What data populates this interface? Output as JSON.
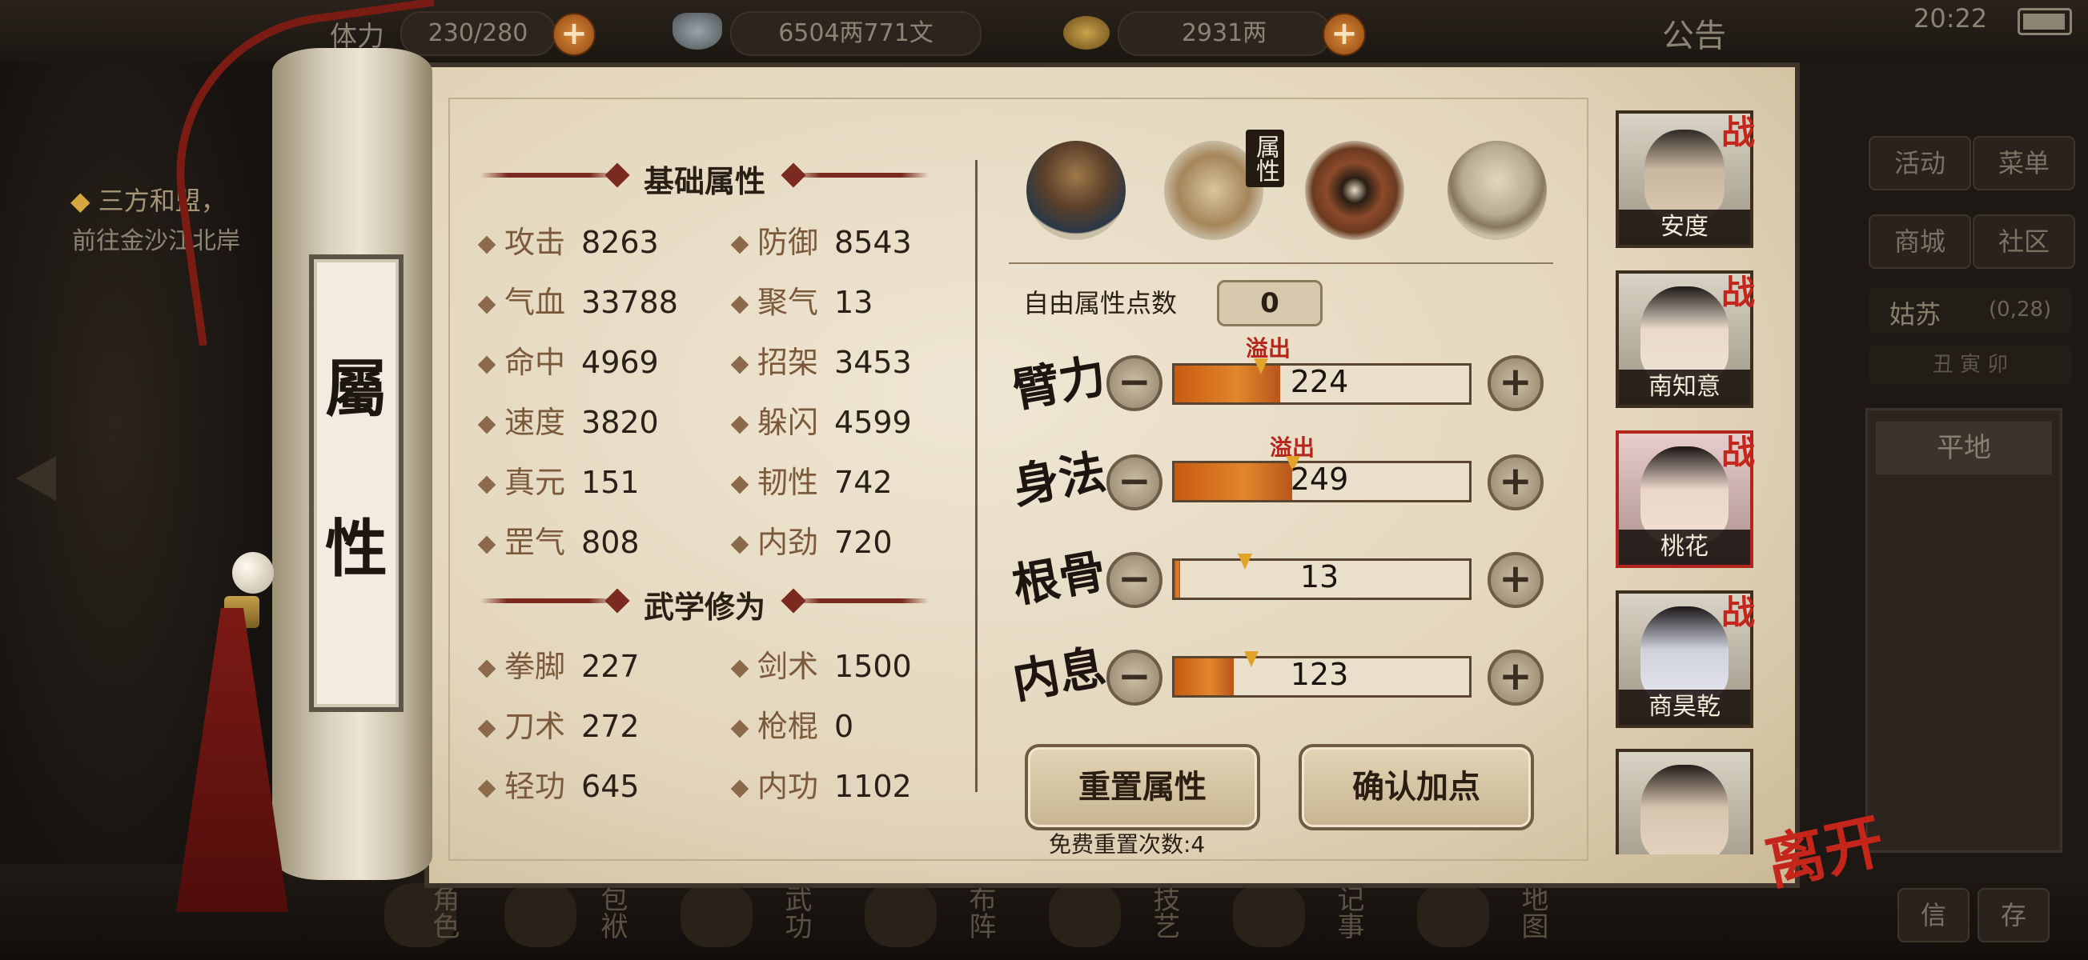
{
  "topbar": {
    "stamina_label": "体力",
    "stamina_value": "230/280",
    "silver_value": "6504两771文",
    "gold_value": "2931两",
    "announcement": "公告",
    "clock": "20:22"
  },
  "left_quest": {
    "title": "三方和盟，",
    "desc": "前往金沙江北岸"
  },
  "right_menu": {
    "activity": "活动",
    "menu": "菜单",
    "mall": "商城",
    "community": "社区",
    "location": "姑苏",
    "coords": "(0,28)",
    "time_line": "丑  寅  卯",
    "terrain": "平地",
    "btn1": "信",
    "btn2": "存"
  },
  "bottom_nav": [
    "角色",
    "包袱",
    "武功",
    "布阵",
    "技艺",
    "记事",
    "地图"
  ],
  "scroll_title": [
    "屬",
    "性"
  ],
  "basic_section": {
    "title": "基础属性",
    "stats": [
      {
        "name": "攻击",
        "value": "8263"
      },
      {
        "name": "防御",
        "value": "8543"
      },
      {
        "name": "气血",
        "value": "33788"
      },
      {
        "name": "聚气",
        "value": "13"
      },
      {
        "name": "命中",
        "value": "4969"
      },
      {
        "name": "招架",
        "value": "3453"
      },
      {
        "name": "速度",
        "value": "3820"
      },
      {
        "name": "躲闪",
        "value": "4599"
      },
      {
        "name": "真元",
        "value": "151"
      },
      {
        "name": "韧性",
        "value": "742"
      },
      {
        "name": "罡气",
        "value": "808"
      },
      {
        "name": "内劲",
        "value": "720"
      }
    ]
  },
  "martial_section": {
    "title": "武学修为",
    "stats": [
      {
        "name": "拳脚",
        "value": "227"
      },
      {
        "name": "剑术",
        "value": "1500"
      },
      {
        "name": "刀术",
        "value": "272"
      },
      {
        "name": "枪棍",
        "value": "0"
      },
      {
        "name": "轻功",
        "value": "645"
      },
      {
        "name": "内功",
        "value": "1102"
      }
    ]
  },
  "tabs": [
    {
      "icon": "straw-hat-character-icon"
    },
    {
      "icon": "scroll-attribute-icon",
      "label": "属性"
    },
    {
      "icon": "bagua-icon"
    },
    {
      "icon": "meridian-body-icon"
    }
  ],
  "free_points": {
    "label": "自由属性点数",
    "value": "0"
  },
  "attributes": [
    {
      "name": "臂力",
      "value": "224",
      "fill": 0.36,
      "overflow": "溢出",
      "marker": 0.3
    },
    {
      "name": "身法",
      "value": "249",
      "fill": 0.4,
      "overflow": "溢出",
      "marker": 0.4
    },
    {
      "name": "根骨",
      "value": "13",
      "fill": 0.02,
      "overflow": "",
      "marker": 0.22
    },
    {
      "name": "内息",
      "value": "123",
      "fill": 0.2,
      "overflow": "",
      "marker": 0.25
    }
  ],
  "buttons": {
    "reset": "重置属性",
    "confirm": "确认加点",
    "free_reset": "免费重置次数:4"
  },
  "party": [
    {
      "name": "安度",
      "battle": "战",
      "selected": false
    },
    {
      "name": "南知意",
      "battle": "战",
      "selected": false
    },
    {
      "name": "桃花",
      "battle": "战",
      "selected": true
    },
    {
      "name": "商昊乾",
      "battle": "战",
      "selected": false
    },
    {
      "name": "",
      "battle": "",
      "selected": false
    }
  ],
  "leave": "离开",
  "colors": {
    "accent_red": "#c5261b",
    "bar_orange": "#d8731f",
    "paper": "#e8dcc4"
  }
}
